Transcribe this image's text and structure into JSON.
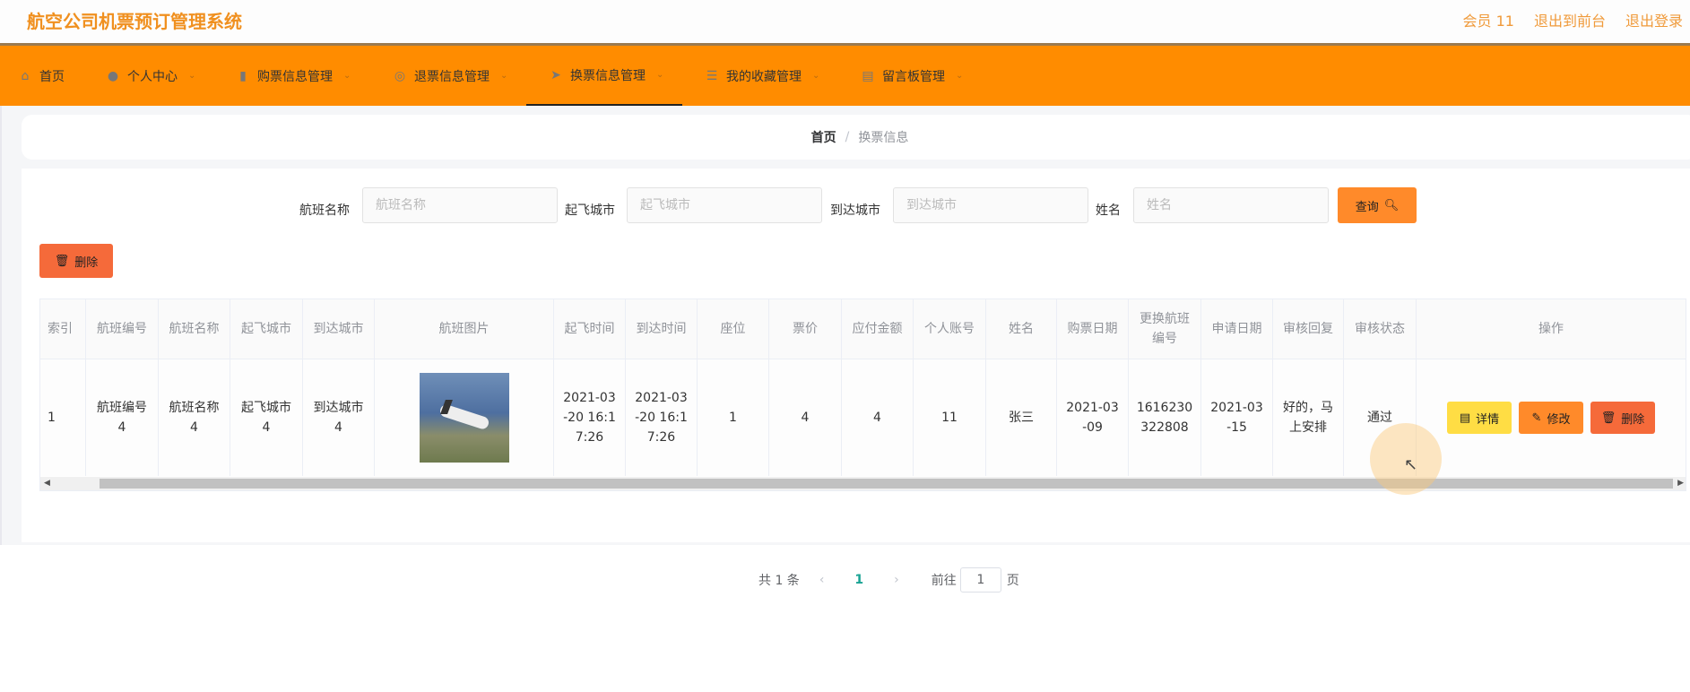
{
  "header": {
    "title": "航空公司机票预订管理系统",
    "links": [
      "会员 11",
      "退出到前台",
      "退出登录"
    ]
  },
  "nav": [
    {
      "label": "首页",
      "icon": "home-icon",
      "glyph": "⌂"
    },
    {
      "label": "个人中心",
      "icon": "user-icon",
      "glyph": "👤"
    },
    {
      "label": "购票信息管理",
      "icon": "chat-icon",
      "glyph": "▮"
    },
    {
      "label": "退票信息管理",
      "icon": "compass-icon",
      "glyph": "◎"
    },
    {
      "label": "换票信息管理",
      "icon": "paper-plane-icon",
      "glyph": "➤"
    },
    {
      "label": "我的收藏管理",
      "icon": "list-icon",
      "glyph": "☰"
    },
    {
      "label": "留言板管理",
      "icon": "briefcase-icon",
      "glyph": "▤"
    }
  ],
  "breadcrumb": {
    "home": "首页",
    "sep": "/",
    "current": "换票信息"
  },
  "search": {
    "fields": [
      {
        "label": "航班名称",
        "placeholder": "航班名称"
      },
      {
        "label": "起飞城市",
        "placeholder": "起飞城市"
      },
      {
        "label": "到达城市",
        "placeholder": "到达城市"
      },
      {
        "label": "姓名",
        "placeholder": "姓名"
      }
    ],
    "query_label": "查询"
  },
  "delete_label": "删除",
  "table": {
    "columns": [
      "索引",
      "航班编号",
      "航班名称",
      "起飞城市",
      "到达城市",
      "航班图片",
      "起飞时间",
      "到达时间",
      "座位",
      "票价",
      "应付金额",
      "个人账号",
      "姓名",
      "购票日期",
      "更换航班编号",
      "申请日期",
      "审核回复",
      "审核状态",
      "操作"
    ],
    "rows": [
      [
        "1",
        "航班编号4",
        "航班名称4",
        "起飞城市4",
        "到达城市4",
        "",
        "2021-03-20 16:17:26",
        "2021-03-20 16:17:26",
        "1",
        "4",
        "4",
        "11",
        "张三",
        "2021-03-09",
        "1616230322808",
        "2021-03-15",
        "好的，马上安排",
        "通过",
        ""
      ]
    ],
    "actions": {
      "detail": "详情",
      "edit": "修改",
      "delete": "删除"
    }
  },
  "pagination": {
    "total": "共 1 条",
    "current": "1",
    "goto": "前往",
    "page_input": "1",
    "page_suffix": "页"
  },
  "colors": {
    "brand": "#ff8c00",
    "detail": "#ffdd44",
    "edit": "#ff8a2a",
    "delete": "#f56a3a"
  }
}
